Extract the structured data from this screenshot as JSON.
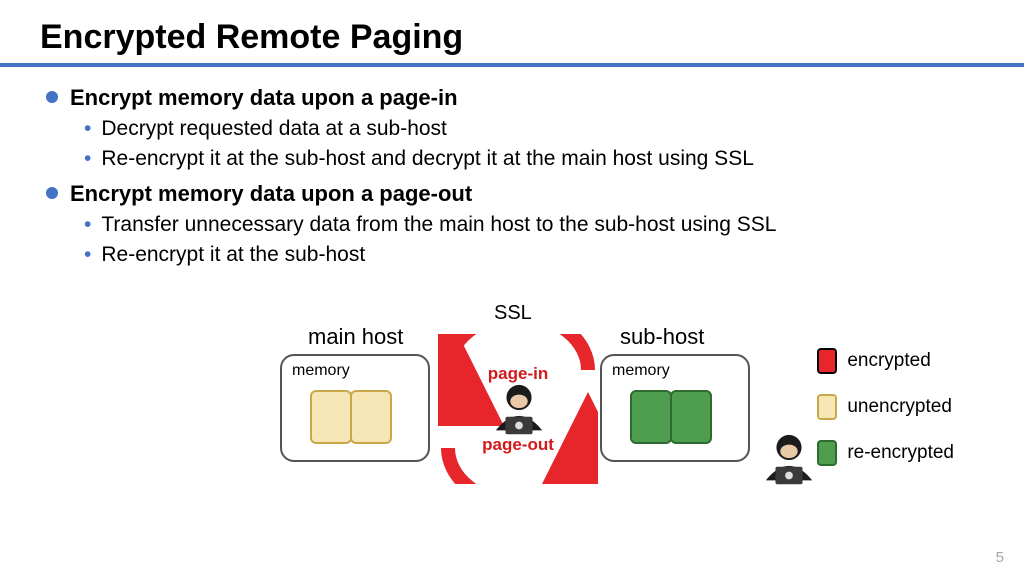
{
  "title": "Encrypted Remote Paging",
  "bullets": [
    {
      "text": "Encrypt memory data upon a page-in",
      "subs": [
        "Decrypt requested data at a sub-host",
        "Re-encrypt it at the sub-host and decrypt it at the main host using SSL"
      ]
    },
    {
      "text": "Encrypt memory data upon a page-out",
      "subs": [
        "Transfer unnecessary data from the main host to the sub-host using SSL",
        "Re-encrypt it at the sub-host"
      ]
    }
  ],
  "diagram": {
    "ssl": "SSL",
    "main_host": "main host",
    "sub_host": "sub-host",
    "memory": "memory",
    "page_in": "page-in",
    "page_out": "page-out"
  },
  "legend": {
    "encrypted": "encrypted",
    "unencrypted": "unencrypted",
    "reencrypted": "re-encrypted"
  },
  "colors": {
    "accent": "#4472c4",
    "arrow": "#e7262c",
    "encrypted": "#e7262c",
    "unencrypted": "#f7e6b5",
    "reencrypted": "#4f9d4f"
  },
  "page_number": "5"
}
